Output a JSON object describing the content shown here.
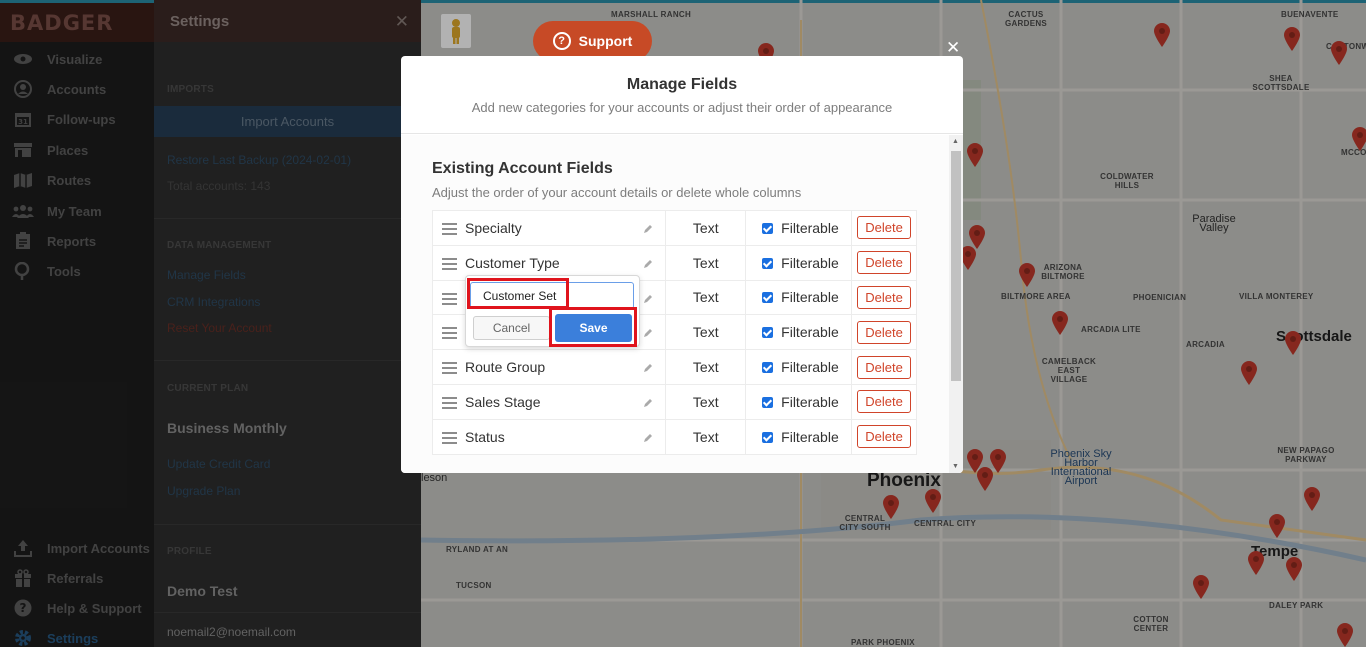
{
  "app": {
    "logo": "BADGER"
  },
  "nav": {
    "items": [
      {
        "label": "Visualize",
        "icon": "eye-icon"
      },
      {
        "label": "Accounts",
        "icon": "person-icon"
      },
      {
        "label": "Follow-ups",
        "icon": "calendar-icon"
      },
      {
        "label": "Places",
        "icon": "store-icon"
      },
      {
        "label": "Routes",
        "icon": "map-icon"
      },
      {
        "label": "My Team",
        "icon": "team-icon"
      },
      {
        "label": "Reports",
        "icon": "clipboard-icon"
      },
      {
        "label": "Tools",
        "icon": "tools-icon"
      }
    ],
    "bottom_items": [
      {
        "label": "Import Accounts",
        "icon": "upload-icon"
      },
      {
        "label": "Referrals",
        "icon": "gift-icon"
      },
      {
        "label": "Help & Support",
        "icon": "help-icon"
      },
      {
        "label": "Settings",
        "icon": "gear-icon"
      }
    ]
  },
  "settings": {
    "title": "Settings",
    "close": "✕",
    "imports": {
      "title": "IMPORTS",
      "button": "Import Accounts",
      "restore": "Restore Last Backup (2024-02-01)",
      "total": "Total accounts: 143"
    },
    "data_management": {
      "title": "DATA MANAGEMENT",
      "manage_fields": "Manage Fields",
      "crm": "CRM Integrations",
      "reset": "Reset Your Account"
    },
    "plan": {
      "title": "CURRENT PLAN",
      "name": "Business Monthly",
      "update_card": "Update Credit Card",
      "upgrade": "Upgrade Plan"
    },
    "profile": {
      "title": "PROFILE",
      "name": "Demo Test",
      "email": "noemail2@noemail.com"
    }
  },
  "support": {
    "label": "Support",
    "icon": "question-circle-icon"
  },
  "modal": {
    "close": "✕",
    "title": "Manage Fields",
    "subtitle": "Add new categories for your accounts or adjust their order of appearance",
    "section_title": "Existing Account Fields",
    "section_desc": "Adjust the order of your account details or delete whole columns",
    "fields": [
      {
        "name": "Specialty",
        "type": "Text",
        "filter": "Filterable",
        "delete": "Delete"
      },
      {
        "name": "Customer Type",
        "type": "Text",
        "filter": "Filterable",
        "delete": "Delete"
      },
      {
        "name": "",
        "type": "Text",
        "filter": "Filterable",
        "delete": "Delete"
      },
      {
        "name": "",
        "type": "Text",
        "filter": "Filterable",
        "delete": "Delete"
      },
      {
        "name": "Route Group",
        "type": "Text",
        "filter": "Filterable",
        "delete": "Delete"
      },
      {
        "name": "Sales Stage",
        "type": "Text",
        "filter": "Filterable",
        "delete": "Delete"
      },
      {
        "name": "Status",
        "type": "Text",
        "filter": "Filterable",
        "delete": "Delete"
      }
    ],
    "edit": {
      "value": "Customer Set",
      "cancel": "Cancel",
      "save": "Save"
    }
  },
  "map": {
    "labels": [
      "MARSHALL RANCH",
      "CACTUS GARDENS",
      "BUENAVENTE",
      "COTTONWO",
      "SHEA SCOTTSDALE",
      "MCCORMICK",
      "COLDWATER HILLS",
      "Paradise Valley",
      "ARIZONA BILTMORE",
      "BILTMORE AREA",
      "PHOENICIAN",
      "VILLA MONTEREY",
      "ARCADIA LITE",
      "ARCADIA",
      "Scottsdale",
      "CAMELBACK EAST VILLAGE",
      "Phoenix Sky Harbor International Airport",
      "Phoenix",
      "CENTRAL CITY SOUTH",
      "CENTRAL CITY",
      "RYLAND AT AN",
      "TUCSON",
      "Tempe",
      "NEW PAPAGO PARKWAY",
      "DALEY PARK",
      "COTTON CENTER",
      "PARK PHOENIX",
      "leson"
    ]
  }
}
